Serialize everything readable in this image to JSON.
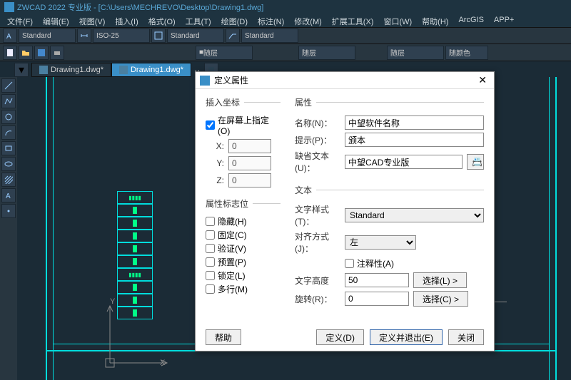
{
  "app": {
    "title": "ZWCAD 2022 专业版 - [C:\\Users\\MECHREVO\\Desktop\\Drawing1.dwg]"
  },
  "menu": [
    "文件(F)",
    "编辑(E)",
    "视图(V)",
    "插入(I)",
    "格式(O)",
    "工具(T)",
    "绘图(D)",
    "标注(N)",
    "修改(M)",
    "扩展工具(X)",
    "窗口(W)",
    "帮助(H)",
    "ArcGIS",
    "APP+"
  ],
  "combos": {
    "std1": "Standard",
    "iso": "ISO-25",
    "std2": "Standard",
    "std3": "Standard",
    "layer1": "随层",
    "layer2": "随层",
    "layer3": "随层",
    "layercolor": "随颜色"
  },
  "tabs": {
    "t1": "Drawing1.dwg*",
    "t2": "Drawing1.dwg*"
  },
  "axes": {
    "x": "X",
    "y": "Y"
  },
  "dialog": {
    "title": "定义属性",
    "groups": {
      "insert": "插入坐标",
      "attrs": "属性",
      "flags": "属性标志位",
      "text": "文本"
    },
    "insert": {
      "screen": "在屏幕上指定(O)",
      "xl": "X:",
      "xv": "0",
      "yl": "Y:",
      "yv": "0",
      "zl": "Z:",
      "zv": "0"
    },
    "attrs": {
      "name_l": "名称(N)：",
      "name_v": "中望软件名称",
      "prompt_l": "提示(P)：",
      "prompt_v": "颁本",
      "default_l": "缺省文本(U)：",
      "default_v": "中望CAD专业版"
    },
    "flags": {
      "hidden": "隐藏(H)",
      "fixed": "固定(C)",
      "verify": "验证(V)",
      "preset": "预置(P)",
      "lock": "锁定(L)",
      "multi": "多行(M)"
    },
    "text": {
      "style_l": "文字样式(T)：",
      "style_v": "Standard",
      "justify_l": "对齐方式(J)：",
      "justify_v": "左",
      "annot": "注释性(A)",
      "height_l": "文字高度",
      "height_v": "50",
      "rot_l": "旋转(R)：",
      "rot_v": "0",
      "pick1": "选择(L) >",
      "pick2": "选择(C) >"
    },
    "buttons": {
      "help": "帮助",
      "define": "定义(D)",
      "define_exit": "定义并退出(E)",
      "close": "关闭"
    }
  }
}
